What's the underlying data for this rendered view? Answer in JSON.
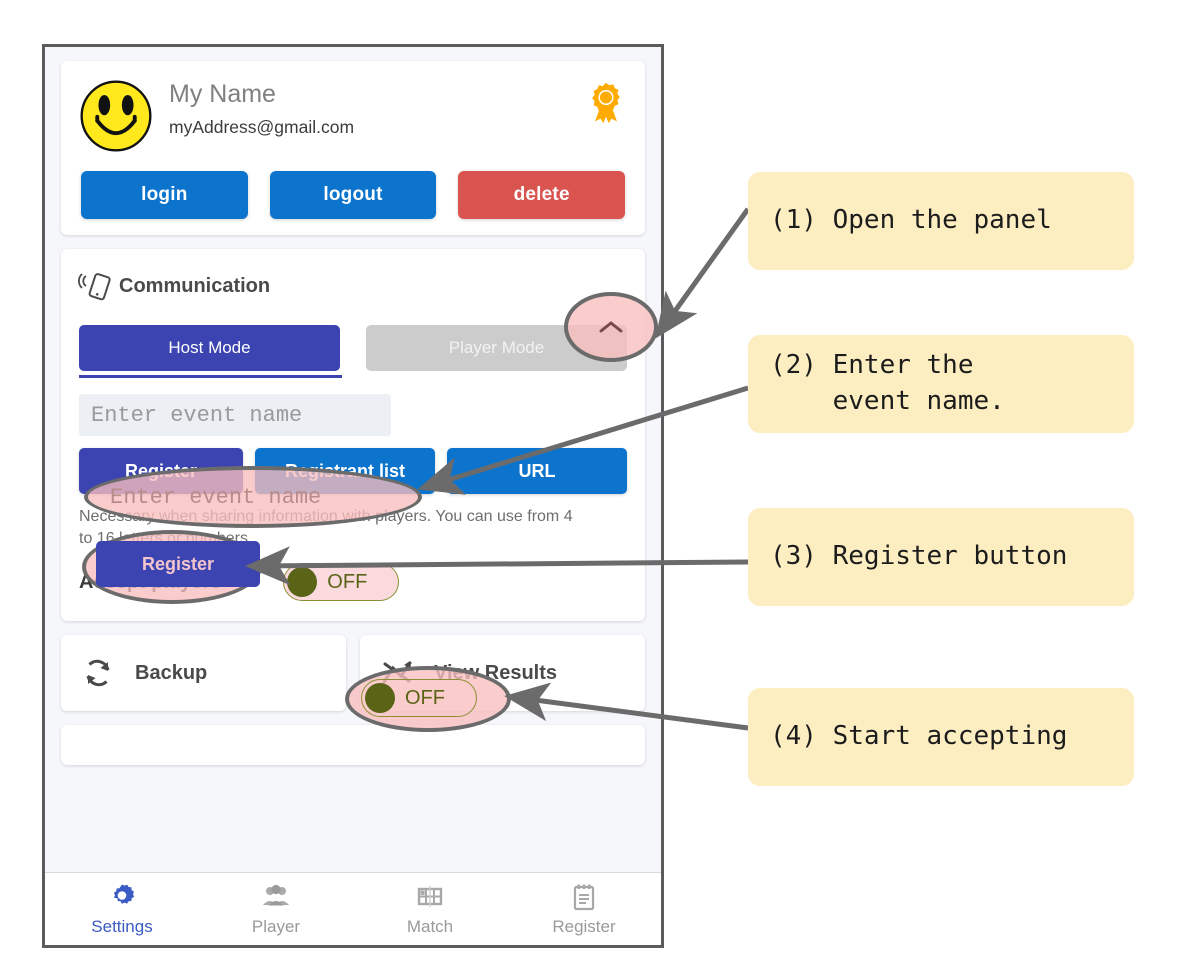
{
  "account": {
    "name": "My Name",
    "email": "myAddress@gmail.com",
    "avatar_icon": "smiley-face-icon",
    "badge_icon": "medal-rosette-icon",
    "buttons": [
      {
        "label": "login",
        "color": "#0d74ce"
      },
      {
        "label": "logout",
        "color": "#0d74ce"
      },
      {
        "label": "delete",
        "color": "#d9534f"
      }
    ]
  },
  "communication": {
    "title": "Communication",
    "icon": "phone-signal-icon",
    "collapse_icon": "chevron-up-icon",
    "modes": [
      {
        "label": "Host Mode",
        "active": true
      },
      {
        "label": "Player Mode",
        "active": false
      }
    ],
    "event_input": {
      "value": "",
      "placeholder": "Enter event name"
    },
    "actions": [
      {
        "label": "Register",
        "color": "#3b44b0"
      },
      {
        "label": "Registrant list",
        "color": "#0d74ce"
      },
      {
        "label": "URL",
        "color": "#0d74ce"
      }
    ],
    "helper_text": "Necessary when sharing information with players. You can use from 4 to 16 letters or numbers.",
    "accept": {
      "label": "Accept players",
      "state": "OFF"
    }
  },
  "tiles": [
    {
      "label": "Backup",
      "icon": "sync-refresh-icon"
    },
    {
      "label": "View Results",
      "icon": "results-chart-icon"
    }
  ],
  "bottom_nav": [
    {
      "label": "Settings",
      "icon": "gear-icon",
      "active": true
    },
    {
      "label": "Player",
      "icon": "people-icon",
      "active": false
    },
    {
      "label": "Match",
      "icon": "bracket-table-icon",
      "active": false
    },
    {
      "label": "Register",
      "icon": "clipboard-icon",
      "active": false
    }
  ],
  "callouts": [
    {
      "id": "c1",
      "text": "(1) Open the panel"
    },
    {
      "id": "c2",
      "text": "(2) Enter the\n    event name."
    },
    {
      "id": "c3",
      "text": "(3) Register button"
    },
    {
      "id": "c4",
      "text": "(4) Start accepting"
    }
  ],
  "colors": {
    "accent_blue": "#0d74ce",
    "indigo": "#3b44b0",
    "danger_red": "#d9534f",
    "callout_bg": "#fdeec2",
    "highlight_pink": "#f8bebe",
    "annotation_gray": "#6b6b6b",
    "toggle_green": "#5a6417",
    "badge_orange": "#ffab00"
  }
}
